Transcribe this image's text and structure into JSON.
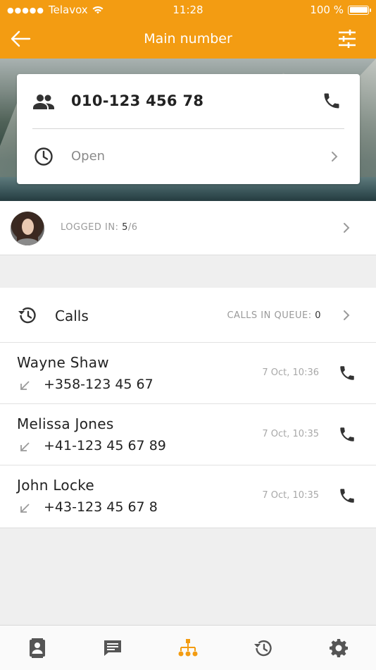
{
  "status": {
    "carrier": "Telavox",
    "time": "11:28",
    "battery": "100 %"
  },
  "nav": {
    "title": "Main number"
  },
  "colors": {
    "accent": "#f39c12",
    "icon_dark": "#333333",
    "muted": "#9a9a9a"
  },
  "number_card": {
    "number": "010-123 456 78",
    "status_label": "Open"
  },
  "agents": {
    "logged_in_label": "LOGGED IN:",
    "logged_in_count": "5",
    "logged_in_total": "/6"
  },
  "calls": {
    "title": "Calls",
    "queue_label": "CALLS IN QUEUE:",
    "queue_count": "0",
    "items": [
      {
        "name": "Wayne Shaw",
        "number": "+358-123 45 67",
        "time": "7 Oct, 10:36"
      },
      {
        "name": "Melissa Jones",
        "number": "+41-123 45 67 89",
        "time": "7 Oct, 10:35"
      },
      {
        "name": "John Locke",
        "number": "+43-123 45 67 8",
        "time": "7 Oct, 10:35"
      }
    ]
  },
  "tabs": [
    {
      "icon": "contacts-icon",
      "active": false
    },
    {
      "icon": "messages-icon",
      "active": false
    },
    {
      "icon": "switchboard-icon",
      "active": true
    },
    {
      "icon": "history-icon",
      "active": false
    },
    {
      "icon": "settings-icon",
      "active": false
    }
  ]
}
